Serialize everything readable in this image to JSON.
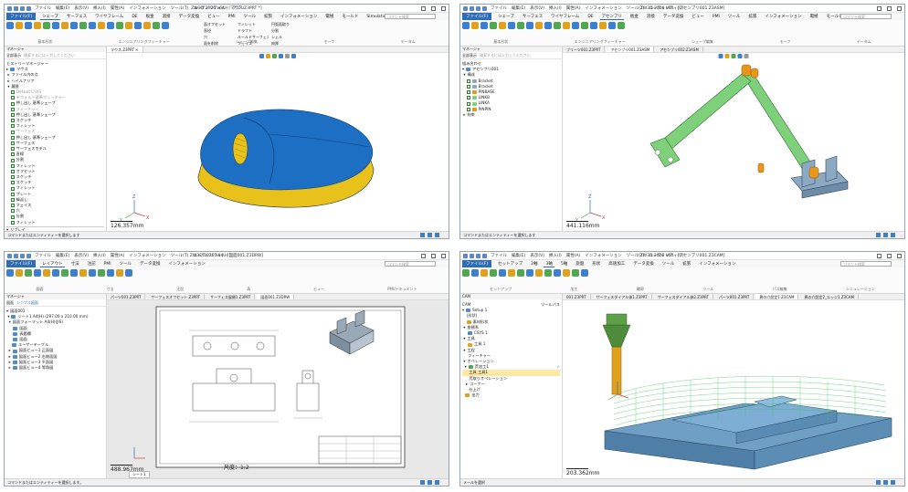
{
  "panels": [
    {
      "window_title": "ZW3D 2026 x64 - [マウス.Z3PRT *]",
      "menu": [
        "ファイル",
        "編集(E)",
        "表示(V)",
        "挿入(I)",
        "属性(A)",
        "インフォメーション",
        "ツール(T)",
        "ユーティリティ(U)",
        "アプリ",
        "ウィンドウ",
        "ヘルプ",
        "ラボ"
      ],
      "tabs": [
        "ファイル(F)",
        "シェープ",
        "サーフェス",
        "ワイヤフレーム",
        "DE",
        "板金",
        "溶接",
        "データ変換",
        "ビュー",
        "PMI",
        "ツール",
        "拡張",
        "インフォメーション",
        "電極",
        "モールド",
        "Simulation",
        "アプリ"
      ],
      "search_placeholder": "コマンド検索",
      "commands": [
        "面オフセット",
        "フィレット",
        "円弧面取り",
        "直径",
        "ドラフト",
        "分割",
        "穴",
        "ルールドサーフェス",
        "シェル",
        "面を削除",
        "フェイス",
        "肉厚"
      ],
      "ribbon_groups": [
        "基本形状",
        "エンジニアリングフィーチャー",
        "シェープ編集",
        "モーフ",
        "データム"
      ],
      "side_header": "マネージャ",
      "filter": [
        "全部表示",
        "検索するには入力してください"
      ],
      "tree": [
        "ヒストリーマネージャー",
        "マウス",
        "ファイル内の点",
        "ヘイルナリア",
        "履歴",
        "Default CSYS",
        "デフォルト基準フィーチャー",
        "押し出し 基準シェープ",
        "フィーチャー",
        "押し出し 基準シェープ",
        "スケッチ",
        "フィレット",
        "サーフェス",
        "押し出し 基準シェープ",
        "サーフェス",
        "サーフェスモデル",
        "直線",
        "分割",
        "フィレット",
        "オフセット",
        "スケッチ",
        "スケッチ",
        "フィレット",
        "プレート",
        "繰返し",
        "フェイス",
        "穴",
        "分割",
        "フィレット"
      ],
      "replay_label": "リプレイ",
      "scale_text": "126.357mm",
      "status_text": "コマンドまたはエンティティーを選択します"
    },
    {
      "window_title": "ZW3D 2026 x64 - [アセンブリ001.Z3ASM]",
      "menu": [
        "ファイル",
        "編集(E)",
        "表示(V)",
        "挿入(I)",
        "属性(A)",
        "インフォメーション",
        "ツール(T)",
        "ユーティリティ(U)",
        "アプリ",
        "ウィンドウ",
        "ヘルプ",
        "ラボ"
      ],
      "tabs": [
        "ファイル(F)",
        "シェープ",
        "サーフェス",
        "ワイヤフレーム",
        "DE",
        "アセンブリ",
        "板金",
        "溶接",
        "データ変換",
        "ビュー",
        "PMI",
        "ツール",
        "拡張",
        "インフォメーション",
        "電極",
        "モールド",
        "Simulation",
        "アプリ"
      ],
      "search_placeholder": "コマンド検索",
      "ribbon_groups": [
        "基本形状",
        "エンジニアリングフィーチャー",
        "シェープ編集",
        "モーフ",
        "データム"
      ],
      "side_header": "マネージャ",
      "filter": [
        "全部表示",
        "検索するには入力してください"
      ],
      "tree": [
        "組み合わせ",
        "アセンブリ001",
        "構成",
        "Bracket",
        "Bracket",
        "PINBASE",
        "LINKB",
        "LINKA",
        "PINPIN",
        "拘束"
      ],
      "vtabs": [
        "ブリーツ001.Z3PRT",
        "アセンブリ001.Z3ASM",
        "アセンブリ002.Z3ASM"
      ],
      "scale_text": "441.116mm",
      "status_text": "コマンドまたはエンティティーを選択します"
    },
    {
      "window_title": "ZW3D 2026 x64 - [図面001.Z3DRW]",
      "menu": [
        "ファイル",
        "編集(E)",
        "表示(V)",
        "挿入(I)",
        "属性(A)",
        "インフォメーション",
        "ツール(T)",
        "ユーティリティ(U)",
        "アプリ",
        "ウィンドウ",
        "ヘルプ",
        "ラボ"
      ],
      "tabs": [
        "ファイル(F)",
        "レイアウト",
        "寸法",
        "注記",
        "PMI",
        "ツール",
        "データ変換",
        "インフォメーション"
      ],
      "search_placeholder": "コマンド検索",
      "ribbon_groups": [
        "図面",
        "寸法",
        "注記",
        "表",
        "ビュー",
        "PMI/ドキュメント"
      ],
      "side_header": "マネージャ",
      "filter": [
        "図面",
        "シンプル図面"
      ],
      "tree": [
        "図面001",
        "シート1 A4(H) (297.00 x 210.00 mm)",
        "図面フォーマット A4(H)(JIS)",
        "図面",
        "表題欄",
        "図面",
        "ユーザーテーブル",
        "図面ビュー1 正面図",
        "図面ビュー2 右側面図",
        "図面ビュー3 平面図",
        "図面ビュー4 等角図"
      ],
      "vtabs": [
        "パーツ001.Z3PRT",
        "サーフェスオフセット.Z3PRT",
        "サーフェス展開1.Z3PRT",
        "図面001.Z3DRW"
      ],
      "sheet_tab": "シート1",
      "scale_ratio": "尺度：1:2",
      "scale_text": "488.967mm",
      "status_text": "コマンドまたはエンティティーを選択します。"
    },
    {
      "window_title": "ZW3D 2026 x64 - [アセンブリ001.Z3CAM]",
      "menu": [
        "ファイル",
        "編集(E)",
        "表示(V)",
        "挿入(I)",
        "属性(A)",
        "インフォメーション",
        "ツール(T)",
        "ユーティリティ(U)",
        "アプリ",
        "ウィンドウ",
        "ヘルプ",
        "ラボ"
      ],
      "tabs": [
        "ファイル(F)",
        "セットアップ",
        "2軸",
        "3軸",
        "5軸",
        "旋盤",
        "形状",
        "高速加工",
        "データ変換",
        "ツール",
        "拡張",
        "インフォメーション"
      ],
      "search_placeholder": "コマンド検索",
      "ribbon_groups": [
        "セットアップ",
        "加工",
        "輪郭",
        "ツール",
        "パス編集",
        "シミュレーション"
      ],
      "side_header": "CAM",
      "tree": [
        "CAM",
        "Setup 1",
        "(形状)",
        "素材形状",
        "座標系",
        "CSYS 1",
        "工具",
        "工具 1",
        "工程",
        "フィーチャー",
        "オペレーション",
        "荒加工1",
        "工具 工具1",
        "荒取りオペレーション",
        "コーナー",
        "仕上げ",
        "出力"
      ],
      "vtabs": [
        "001.Z3PRT",
        "サーフェスダイアル体1.Z3PRT",
        "サーフェスダイアル体2.Z3PRT",
        "パーツ001.Z3PRT",
        "異の穴設定1.Z3CAM",
        "異の穴設定2_エッジ1.Z3CAM"
      ],
      "tool_label": "ツールパス",
      "scale_text": "203.362mm",
      "status_text": "メールを選択"
    }
  ],
  "colors": {
    "file_tab": "#2e6db6",
    "mouse_top": "#1d6fc4",
    "mouse_bottom": "#e8c21a",
    "assembly_green": "#7fd07a",
    "assembly_orange": "#e8971c",
    "steel": "#8ca9c4",
    "cam_stock": "#6f9fc4",
    "toolpath_green": "#39c35a"
  }
}
